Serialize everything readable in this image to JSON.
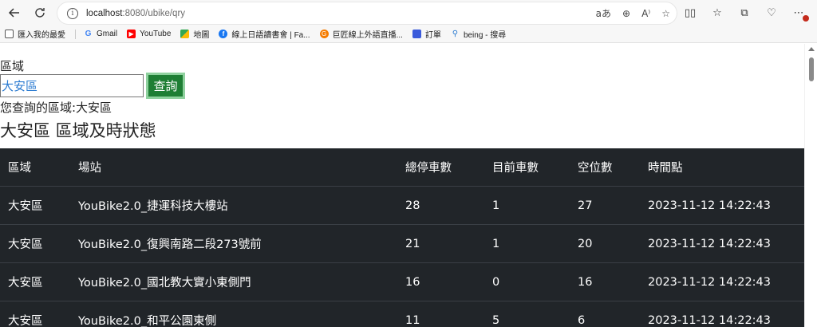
{
  "browser": {
    "url_host": "localhost",
    "url_rest": ":8080/ubike/qry",
    "addr_icons": [
      "aあ",
      "⊕",
      "A⁾",
      "☆"
    ],
    "bookmarks": [
      {
        "label": "匯入我的最愛",
        "icon": "folder-icon",
        "color": "#555555"
      },
      {
        "label": "Gmail",
        "icon": "google-icon",
        "color": "#4285f4"
      },
      {
        "label": "YouTube",
        "icon": "youtube-icon",
        "color": "#ff0000"
      },
      {
        "label": "地圖",
        "icon": "maps-icon",
        "color": "#34a853"
      },
      {
        "label": "線上日語讀書會 | Fa...",
        "icon": "facebook-icon",
        "color": "#1877f2"
      },
      {
        "label": "巨匠線上外語直播...",
        "icon": "orange-g-icon",
        "color": "#f57c00"
      },
      {
        "label": "訂單",
        "icon": "book-icon",
        "color": "#3b5bdb"
      },
      {
        "label": "being - 搜尋",
        "icon": "search-icon",
        "color": "#2b7bd1"
      }
    ]
  },
  "form": {
    "area_label": "區域",
    "input_value": "大安區",
    "button_label": "查詢"
  },
  "result_text": "您查詢的區域:大安區",
  "heading": "大安區 區域及時狀態",
  "table": {
    "headers": [
      "區域",
      "場站",
      "總停車數",
      "目前車數",
      "空位數",
      "時間點"
    ],
    "rows": [
      [
        "大安區",
        "YouBike2.0_捷運科技大樓站",
        "28",
        "1",
        "27",
        "2023-11-12 14:22:43"
      ],
      [
        "大安區",
        "YouBike2.0_復興南路二段273號前",
        "21",
        "1",
        "20",
        "2023-11-12 14:22:43"
      ],
      [
        "大安區",
        "YouBike2.0_國北教大實小東側門",
        "16",
        "0",
        "16",
        "2023-11-12 14:22:43"
      ],
      [
        "大安區",
        "YouBike2.0_和平公園東側",
        "11",
        "5",
        "6",
        "2023-11-12 14:22:43"
      ]
    ]
  }
}
